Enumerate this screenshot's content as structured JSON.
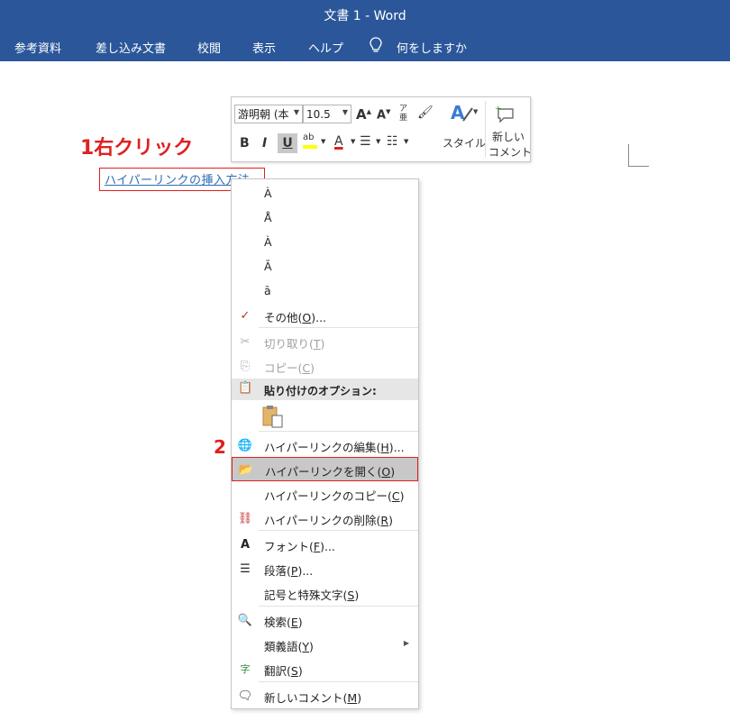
{
  "window": {
    "title": "文書 1  -  Word"
  },
  "ribbon": {
    "tabs": [
      "参考資料",
      "差し込み文書",
      "校閲",
      "表示",
      "ヘルプ"
    ],
    "tell_me": "何をしますか"
  },
  "annotations": {
    "step1": "1右クリック",
    "step2": "2"
  },
  "document": {
    "link_text": "ハイパーリンクの挿入方法"
  },
  "mini_toolbar": {
    "font_name": "游明朝 (本",
    "font_size": "10.5",
    "style_label": "スタイル",
    "new_comment_line1": "新しい",
    "new_comment_line2": "コメント"
  },
  "context_menu": {
    "accent_items": [
      "À",
      "Å",
      "À",
      "Ā",
      "ā"
    ],
    "more": {
      "text": "その他(",
      "key": "O",
      "tail": ")..."
    },
    "cut": {
      "text": "切り取り(",
      "key": "T",
      "tail": ")"
    },
    "copy": {
      "text": "コピー(",
      "key": "C",
      "tail": ")"
    },
    "paste_options": "貼り付けのオプション:",
    "edit_hyperlink": {
      "text": "ハイパーリンクの編集(",
      "key": "H",
      "tail": ")..."
    },
    "open_hyperlink": {
      "text": "ハイパーリンクを開く(",
      "key": "O",
      "tail": ")"
    },
    "copy_hyperlink": {
      "text": "ハイパーリンクのコピー(",
      "key": "C",
      "tail": ")"
    },
    "remove_hyperlink": {
      "text": "ハイパーリンクの削除(",
      "key": "R",
      "tail": ")"
    },
    "font": {
      "text": "フォント(",
      "key": "F",
      "tail": ")..."
    },
    "paragraph": {
      "text": "段落(",
      "key": "P",
      "tail": ")..."
    },
    "symbols": {
      "text": "記号と特殊文字(",
      "key": "S",
      "tail": ")"
    },
    "search": {
      "text": "検索(",
      "key": "E",
      "tail": ")"
    },
    "synonyms": {
      "text": "類義語(",
      "key": "Y",
      "tail": ")"
    },
    "translate": {
      "text": "翻訳(",
      "key": "S",
      "tail": ")"
    },
    "new_comment": {
      "text": "新しいコメント(",
      "key": "M",
      "tail": ")"
    }
  },
  "colors": {
    "ribbon": "#2b579a",
    "annotation": "#e02020",
    "link": "#2e6db5",
    "highlight_yellow": "#ffff00",
    "font_red": "#e02020"
  }
}
